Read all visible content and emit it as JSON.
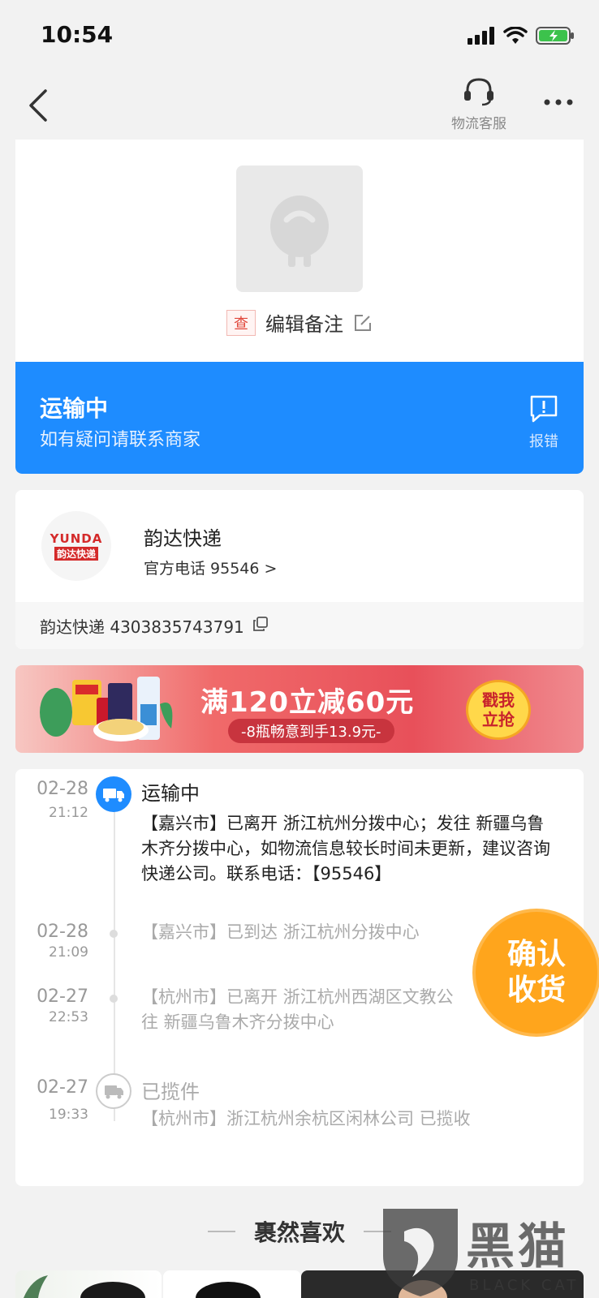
{
  "status_bar": {
    "time": "10:54"
  },
  "nav": {
    "service_label": "物流客服"
  },
  "package": {
    "check_tag": "查",
    "note_label": "编辑备注",
    "status_title": "运输中",
    "status_sub": "如有疑问请联系商家",
    "report_label": "报错"
  },
  "carrier": {
    "logo_en": "YUNDA",
    "logo_cn": "韵达快递",
    "name": "韵达快递",
    "phone": "官方电话 95546 >",
    "tracking": "韵达快递 4303835743791"
  },
  "ad": {
    "title": "满120立减60元",
    "subtitle": "-8瓶畅意到手13.9元-",
    "button": "戳我立抢"
  },
  "timeline": [
    {
      "date": "02-28",
      "time": "21:12",
      "status": "运输中",
      "desc": "【嘉兴市】已离开 浙江杭州分拨中心；发往 新疆乌鲁木齐分拨中心，如物流信息较长时间未更新，建议咨询快递公司。联系电话：【95546】"
    },
    {
      "date": "02-28",
      "time": "21:09",
      "status": "",
      "desc": "【嘉兴市】已到达 浙江杭州分拨中心"
    },
    {
      "date": "02-27",
      "time": "22:53",
      "status": "",
      "desc": "【杭州市】已离开 浙江杭州西湖区文教公\n往 新疆乌鲁木齐分拨中心"
    },
    {
      "date": "02-27",
      "time": "19:33",
      "status": "已揽件",
      "desc": "【杭州市】浙江杭州余杭区闲林公司 已揽收"
    }
  ],
  "confirm_button": "确认收货",
  "recommend": {
    "title": "裹然喜欢"
  },
  "watermark": {
    "cn": "黑猫",
    "en": "BLACK CAT"
  },
  "colors": {
    "accent_blue": "#1e8cff",
    "confirm_orange": "#ffa51c",
    "yunda_red": "#d42a2a"
  }
}
